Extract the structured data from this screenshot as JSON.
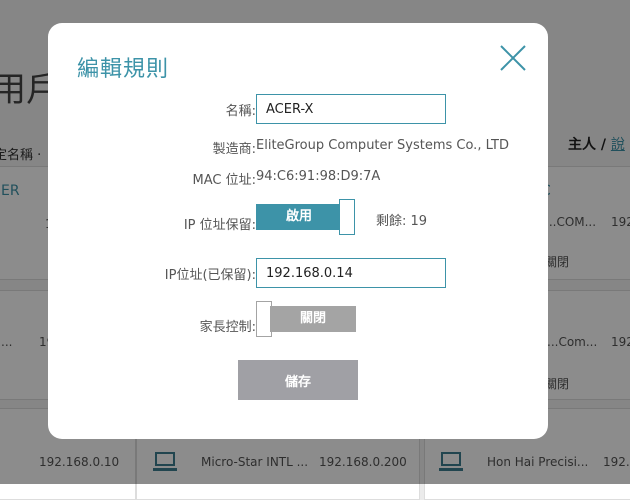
{
  "background": {
    "title": "用戶",
    "filter_label": "定名稱 ·",
    "owner_label": "主人 /",
    "owner_link": "說",
    "card1_accent": "ER",
    "card1_right_accent": "C",
    "card1_right_vendor": "...COM...",
    "card1_right_ip": "192",
    "card1_right_status": "關閉",
    "card1_left_ip": "1",
    "card2_left_vendor": "...",
    "card2_left_ip": "19",
    "card2_right_vendor": "...Com...",
    "card2_right_ip": "192",
    "card2_right_status": "關閉",
    "row3_ip1": "192.168.0.10",
    "row3_vendor2": "Micro-Star INTL ...",
    "row3_ip2": "192.168.0.200",
    "row3_vendor3": "Hon Hai Precisi...",
    "row3_ip3": "192."
  },
  "modal": {
    "title": "編輯規則",
    "name_label": "名稱:",
    "name_value": "ACER-X",
    "vendor_label": "製造商:",
    "vendor_value": "EliteGroup Computer Systems Co., LTD",
    "mac_label": "MAC 位址:",
    "mac_value": "94:C6:91:98:D9:7A",
    "ip_reserve_label": "IP 位址保留:",
    "ip_reserve_state": "啟用",
    "remaining_text": "剩餘: 19",
    "ip_label": "IP位址(已保留):",
    "ip_value": "192.168.0.14",
    "parental_label": "家長控制:",
    "parental_state": "關閉",
    "save_label": "儲存"
  },
  "colors": {
    "accent": "#3d93a8",
    "toggle_off": "#a4a4a4",
    "save_button": "#a0a0a5",
    "overlay": "rgba(0,0,0,0.45)"
  }
}
